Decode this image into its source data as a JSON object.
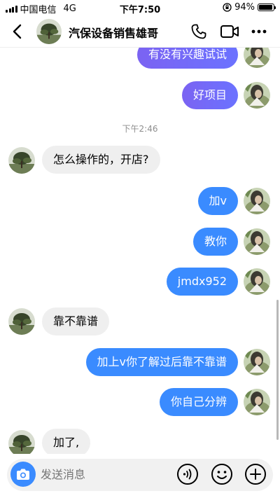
{
  "status_bar": {
    "carrier": "中国电信",
    "network": "4G",
    "time": "下午7:50",
    "battery": "94%",
    "battery_level": 0.94
  },
  "header": {
    "title": "汽保设备销售雄哥"
  },
  "messages": [
    {
      "sender": "self",
      "text": "有没有兴趣试试"
    },
    {
      "sender": "self",
      "text": "好项目"
    },
    {
      "type": "timestamp",
      "text": "下午2:46"
    },
    {
      "sender": "other",
      "text": "怎么操作的，开店?"
    },
    {
      "sender": "self",
      "text": "加v"
    },
    {
      "sender": "self",
      "text": "教你"
    },
    {
      "sender": "self",
      "text": "jmdx952"
    },
    {
      "sender": "other",
      "text": "靠不靠谱"
    },
    {
      "sender": "self",
      "text": "加上v你了解过后靠不靠谱"
    },
    {
      "sender": "self",
      "text": "你自己分辨"
    },
    {
      "sender": "other",
      "text": "加了,"
    }
  ],
  "input": {
    "placeholder": "发送消息"
  },
  "colors": {
    "bubble_self": "#3a8bff",
    "bubble_other": "#efefef",
    "accent": "#3a8bff"
  },
  "icons": [
    "back-icon",
    "phone-icon",
    "video-icon",
    "more-icon",
    "camera-icon",
    "voice-icon",
    "emoji-icon",
    "plus-icon"
  ]
}
